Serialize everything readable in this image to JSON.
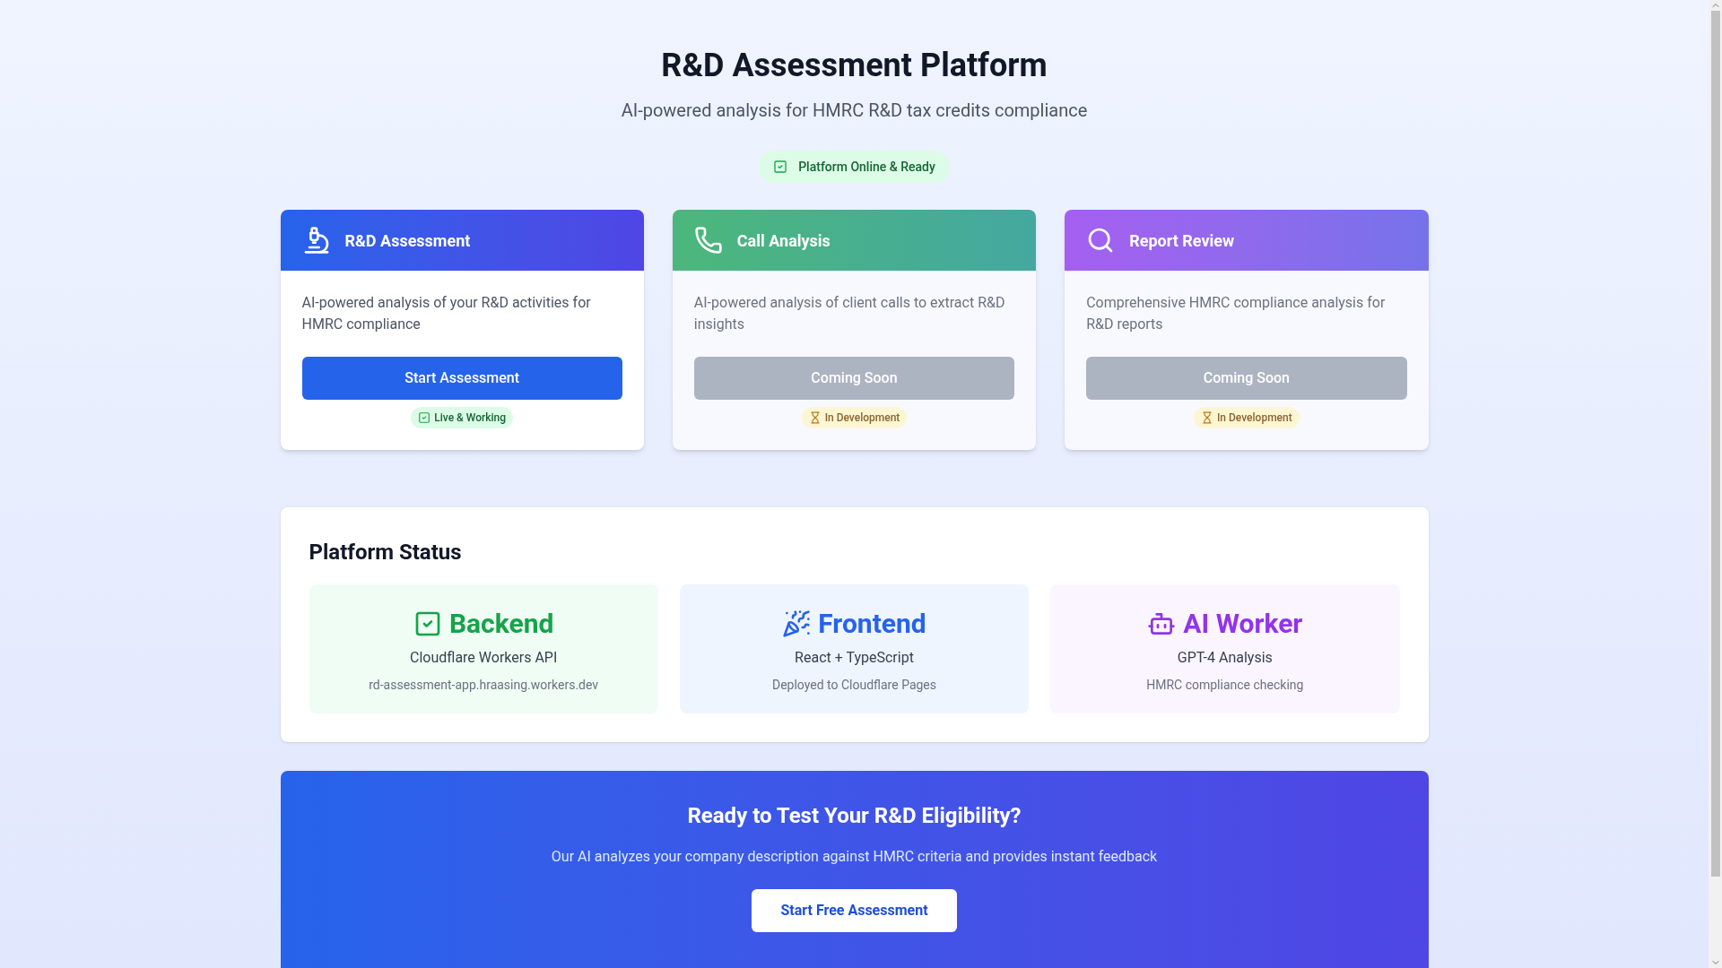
{
  "header": {
    "title": "R&D Assessment Platform",
    "subtitle": "AI-powered analysis for HMRC R&D tax credits compliance",
    "status_badge": "Platform Online & Ready"
  },
  "tools": [
    {
      "kind": "assessment",
      "title": "R&D Assessment",
      "description": "AI-powered analysis of your R&D activities for HMRC compliance",
      "button": "Start Assessment",
      "disabled": false,
      "status": {
        "kind": "live",
        "label": "Live & Working"
      }
    },
    {
      "kind": "calls",
      "title": "Call Analysis",
      "description": "AI-powered analysis of client calls to extract R&D insights",
      "button": "Coming Soon",
      "disabled": true,
      "status": {
        "kind": "dev",
        "label": "In Development"
      }
    },
    {
      "kind": "review",
      "title": "Report Review",
      "description": "Comprehensive HMRC compliance analysis for R&D reports",
      "button": "Coming Soon",
      "disabled": true,
      "status": {
        "kind": "dev",
        "label": "In Development"
      }
    }
  ],
  "platform_status": {
    "title": "Platform Status",
    "items": [
      {
        "kind": "backend",
        "name": "Backend",
        "detail": "Cloudflare Workers API",
        "note": "rd-assessment-app.hraasing.workers.dev"
      },
      {
        "kind": "frontend",
        "name": "Frontend",
        "detail": "React + TypeScript",
        "note": "Deployed to Cloudflare Pages"
      },
      {
        "kind": "ai",
        "name": "AI Worker",
        "detail": "GPT-4 Analysis",
        "note": "HMRC compliance checking"
      }
    ]
  },
  "cta": {
    "title": "Ready to Test Your R&D Eligibility?",
    "text": "Our AI analyzes your company description against HMRC criteria and provides instant feedback",
    "button": "Start Free Assessment"
  }
}
